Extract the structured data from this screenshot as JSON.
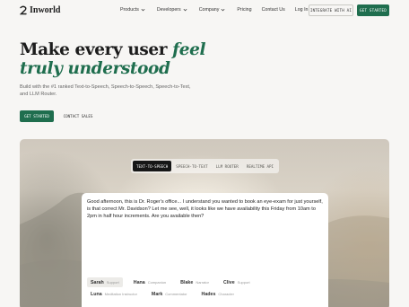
{
  "header": {
    "logo_text": "Inworld",
    "menu": [
      {
        "label": "Products",
        "has_dropdown": true
      },
      {
        "label": "Developers",
        "has_dropdown": true
      },
      {
        "label": "Company",
        "has_dropdown": true
      },
      {
        "label": "Pricing",
        "has_dropdown": false
      },
      {
        "label": "Contact Us",
        "has_dropdown": false
      },
      {
        "label": "Log In",
        "has_dropdown": false
      }
    ],
    "integrate_label": "INTEGRATE WITH AI",
    "get_started_label": "GET STARTED"
  },
  "hero": {
    "title_plain": "Make every user ",
    "title_accent_1": "feel",
    "title_accent_2": "truly understood",
    "subtitle": "Build with the #1 ranked Text-to-Speech, Speech-to-Speech, Speech-to-Text, and LLM Router.",
    "get_started_label": "GET STARTED",
    "contact_sales_label": "CONTACT SALES"
  },
  "demo": {
    "tabs": [
      {
        "label": "TEXT-TO-SPEECH",
        "active": true
      },
      {
        "label": "SPEECH-TO-TEXT",
        "active": false
      },
      {
        "label": "LLM ROUTER",
        "active": false
      },
      {
        "label": "REALTIME API",
        "active": false
      }
    ],
    "transcript": "Good afternoon, this is Dr. Roger's office... I understand you wanted to book an eye-exam for just yourself, is that correct Mr. Davidson? Let me see, well, it looks like we have availability this Friday from 10am to 2pm in half hour increments. Are you available then?",
    "voices": [
      {
        "name": "Sarah",
        "tag": "Support",
        "selected": true
      },
      {
        "name": "Hana",
        "tag": "Companion",
        "selected": false
      },
      {
        "name": "Blake",
        "tag": "Narrator",
        "selected": false
      },
      {
        "name": "Clive",
        "tag": "Support",
        "selected": false
      },
      {
        "name": "Luna",
        "tag": "Meditation Instructor",
        "selected": false
      },
      {
        "name": "Mark",
        "tag": "Commentator",
        "selected": false
      },
      {
        "name": "Hades",
        "tag": "Character",
        "selected": false
      }
    ]
  },
  "colors": {
    "brand_green": "#1f6e4e",
    "page_bg": "#f7f6f4",
    "active_tab": "#161616"
  }
}
